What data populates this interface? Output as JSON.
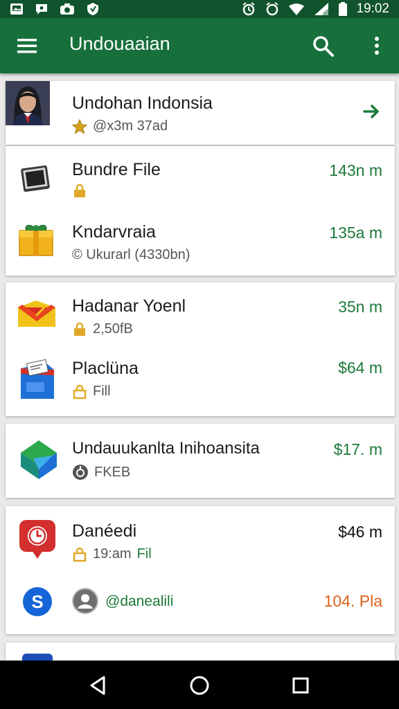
{
  "status_bar": {
    "time": "19:02",
    "icons": [
      "gallery-icon",
      "chat-icon",
      "camera-icon",
      "shield-icon",
      "alarm-icon",
      "alarm-icon",
      "wifi-icon",
      "signal-icon",
      "battery-icon"
    ]
  },
  "app_bar": {
    "title": "Undouaaian",
    "icons": [
      "menu-icon",
      "search-icon",
      "more-vert-icon"
    ]
  },
  "profile": {
    "name": "Undohan Indonsia",
    "subtitle": "@x3m 37ad",
    "action_icon": "arrow-right-icon"
  },
  "cards": [
    {
      "items": [
        {
          "name": "Bundre File",
          "sub": "",
          "price": "143n m",
          "icon": "tablet-device-icon"
        },
        {
          "name": "Kndarvraia",
          "sub": "© Ukurarl (4330bn)",
          "price": "135a m",
          "icon": "gift-box-icon"
        }
      ]
    },
    {
      "items": [
        {
          "name": "Hadanar Yoenl",
          "sub": "2,50fB",
          "price": "35n m",
          "icon": "envelope-icon"
        },
        {
          "name": "Placlüna",
          "sub": "Fill",
          "price": "$64 m",
          "icon": "ticket-box-icon"
        }
      ]
    },
    {
      "items": [
        {
          "name": "Undauukanlta Inihoansita",
          "sub": "FKEB",
          "price": "$17. m",
          "icon": "green-cube-icon"
        }
      ]
    },
    {
      "items": [
        {
          "name": "Danéedi",
          "sub": "19:am",
          "sub_extra": "Fil",
          "price": "$46 m",
          "icon": "clock-pin-icon"
        },
        {
          "name": "@danealili",
          "sub": "",
          "price": "104. Pla",
          "icon": "dollar-circle-icon"
        }
      ]
    }
  ],
  "colors": {
    "status_bar": "#10532c",
    "app_bar": "#17703b",
    "price_green": "#1d7a3a",
    "price_orange": "#d9621a"
  },
  "nav_bar": {
    "icons": [
      "back-triangle-icon",
      "home-circle-icon",
      "recents-square-icon"
    ]
  }
}
